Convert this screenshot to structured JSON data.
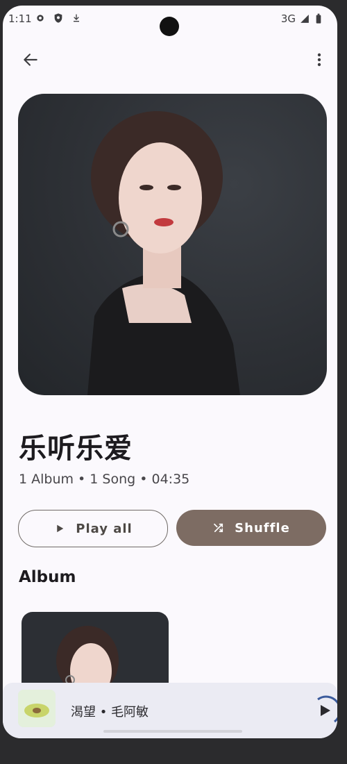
{
  "status_bar": {
    "time": "1:11",
    "network": "3G",
    "icons": [
      "settings-icon",
      "shield-icon",
      "download-icon",
      "signal-icon",
      "battery-icon"
    ]
  },
  "app_bar": {
    "back_icon": "arrow-back-icon",
    "more_icon": "more-vert-icon"
  },
  "artist": {
    "name": "乐听乐爱",
    "meta": "1 Album • 1 Song • 04:35"
  },
  "actions": {
    "play_all_label": "Play all",
    "shuffle_label": "Shuffle"
  },
  "sections": {
    "album_title": "Album"
  },
  "mini_player": {
    "title": "渴望 • 毛阿敏",
    "play_icon": "play-icon"
  },
  "colors": {
    "accent": "#7d6c63",
    "background": "#fbf9fd",
    "mini_player_bg": "#ebebf3"
  }
}
